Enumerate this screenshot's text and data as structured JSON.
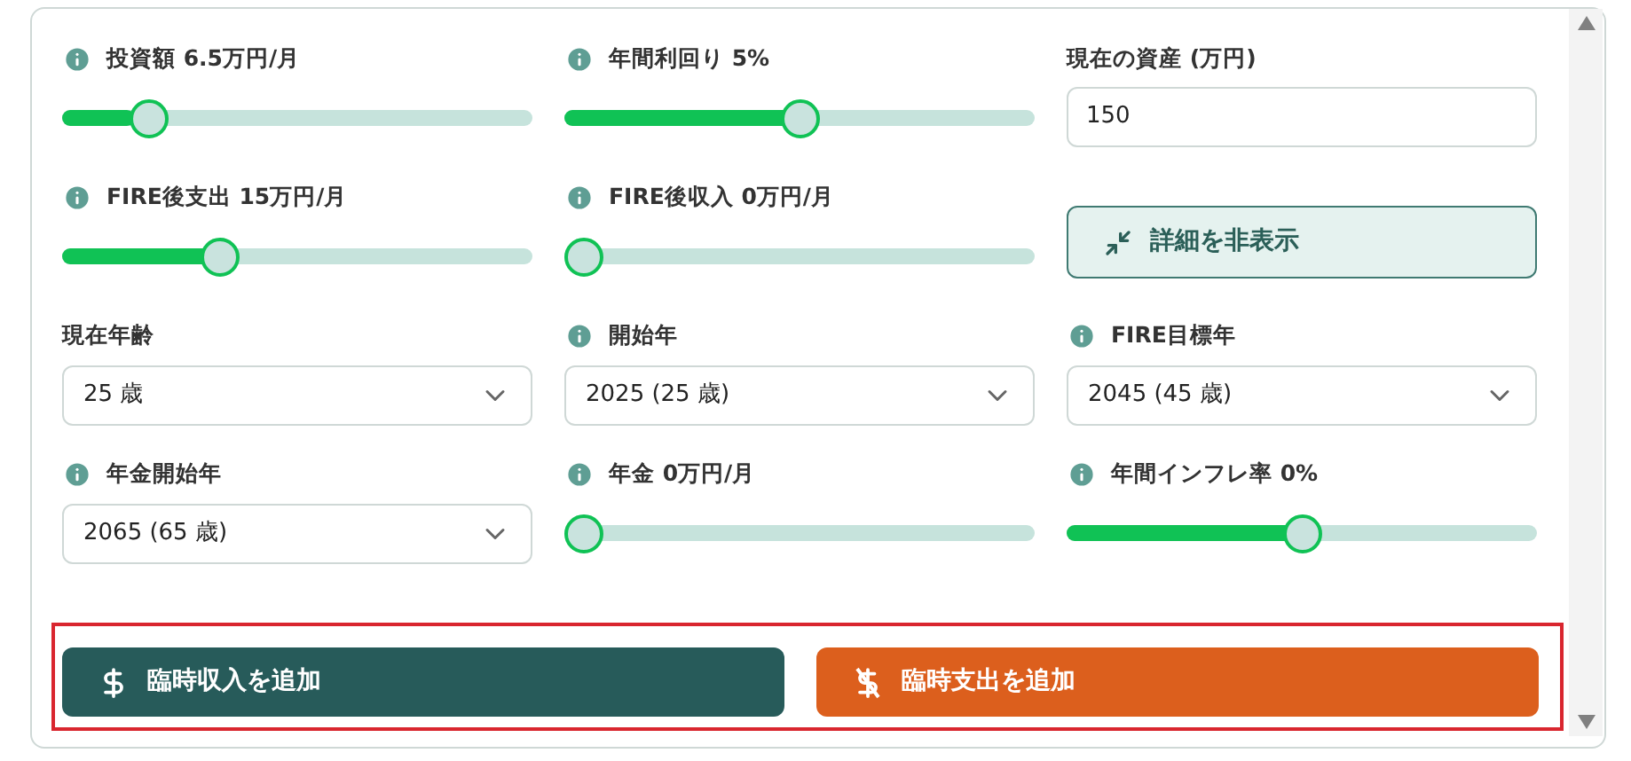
{
  "fields": [
    {
      "kind": "slider",
      "label": "投資額 6.5万円/月",
      "info": true,
      "level": 0.155
    },
    {
      "kind": "slider",
      "label": "年間利回り 5%",
      "info": true,
      "level": 0.5
    },
    {
      "kind": "number",
      "label": "現在の資産 (万円)",
      "info": false,
      "value": "150"
    },
    {
      "kind": "slider",
      "label": "FIRE後支出 15万円/月",
      "info": true,
      "level": 0.32
    },
    {
      "kind": "slider",
      "label": "FIRE後収入 0万円/月",
      "info": true,
      "level": 0
    },
    {
      "kind": "toggle",
      "label": "詳細を非表示"
    },
    {
      "kind": "select",
      "label": "現在年齢",
      "info": false,
      "value": "25 歳"
    },
    {
      "kind": "select",
      "label": "開始年",
      "info": true,
      "value": "2025 (25 歳)"
    },
    {
      "kind": "select",
      "label": "FIRE目標年",
      "info": true,
      "value": "2045 (45 歳)"
    },
    {
      "kind": "select",
      "label": "年金開始年",
      "info": true,
      "value": "2065 (65 歳)"
    },
    {
      "kind": "slider",
      "label": "年金 0万円/月",
      "info": true,
      "level": 0
    },
    {
      "kind": "slider",
      "label": "年間インフレ率 0%",
      "info": true,
      "level": 0.5
    }
  ],
  "actions": [
    {
      "kind": "income",
      "label": "臨時収入を追加"
    },
    {
      "kind": "expense",
      "label": "臨時支出を追加"
    }
  ]
}
